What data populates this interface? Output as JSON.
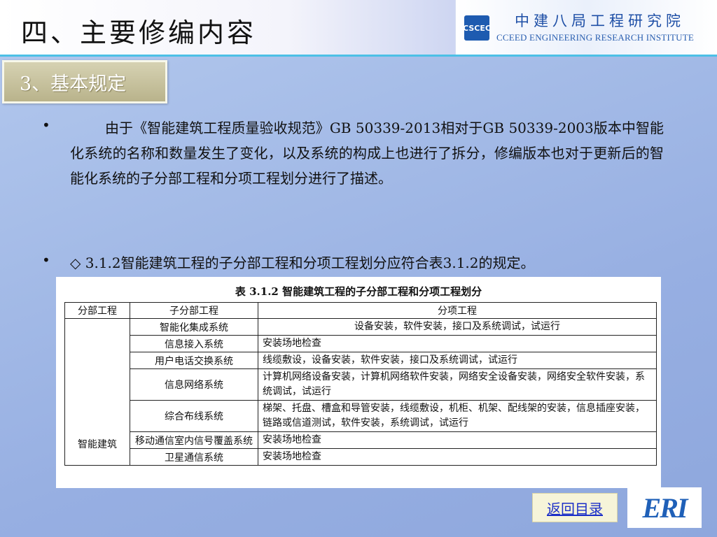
{
  "header": {
    "title": "四、主要修编内容",
    "org_logo_text": "CSCEC",
    "org_name_cn": "中建八局工程研究院",
    "org_name_en": "CCEED ENGINEERING RESEARCH INSTITUTE"
  },
  "section": {
    "label": "3、基本规定"
  },
  "bullets": [
    {
      "marker": "•",
      "text": "由于《智能建筑工程质量验收规范》GB 50339-2013相对于GB 50339-2003版本中智能化系统的名称和数量发生了变化，以及系统的构成上也进行了拆分，修编版本也对于更新后的智能化系统的子分部工程和分项工程划分进行了描述。"
    },
    {
      "marker": "•",
      "text": "◇ 3.1.2智能建筑工程的子分部工程和分项工程划分应符合表3.1.2的规定。"
    }
  ],
  "table": {
    "caption": "表 3.1.2 智能建筑工程的子分部工程和分项工程划分",
    "headers": [
      "分部工程",
      "子分部工程",
      "分项工程"
    ],
    "division": "智能建筑",
    "rows": [
      {
        "sub": "智能化集成系统",
        "items": "设备安装，软件安装，接口及系统调试，试运行"
      },
      {
        "sub": "信息接入系统",
        "items": "安装场地检查"
      },
      {
        "sub": "用户电话交换系统",
        "items": "线缆敷设，设备安装，软件安装，接口及系统调试，试运行"
      },
      {
        "sub": "信息网络系统",
        "items": "计算机网络设备安装，计算机网络软件安装，网络安全设备安装，网络安全软件安装，系统调试，试运行"
      },
      {
        "sub": "综合布线系统",
        "items": "梯架、托盘、槽盒和导管安装，线缆敷设，机柜、机架、配线架的安装，信息插座安装，链路或信道测试，软件安装，系统调试，试运行"
      },
      {
        "sub": "移动通信室内信号覆盖系统",
        "items": "安装场地检查"
      },
      {
        "sub": "卫星通信系统",
        "items": "安装场地检查"
      }
    ]
  },
  "footer": {
    "return_label": "返回目录",
    "logo_text": "ERI"
  }
}
